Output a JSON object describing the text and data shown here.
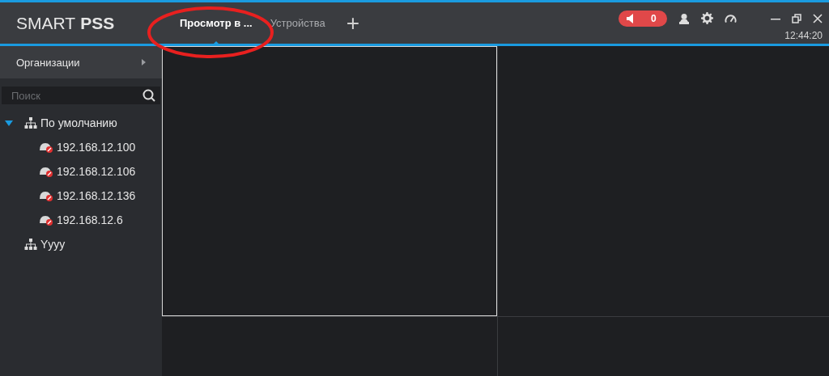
{
  "app": {
    "logo_light": "SMART",
    "logo_bold": "PSS"
  },
  "tabs": [
    {
      "label": "Просмотр в ...",
      "selected": true
    },
    {
      "label": "Устройства",
      "selected": false
    }
  ],
  "add_tab": "+",
  "alarm": {
    "count": "0"
  },
  "clock": "12:44:20",
  "sidebar": {
    "header": "Организации",
    "search": {
      "placeholder": "Поиск"
    },
    "tree": [
      {
        "label": "По умолчанию",
        "expanded": true,
        "children": [
          {
            "label": "192.168.12.100"
          },
          {
            "label": "192.168.12.106"
          },
          {
            "label": "192.168.12.136"
          },
          {
            "label": "192.168.12.6"
          }
        ]
      },
      {
        "label": "Yyyy"
      }
    ]
  },
  "video_tiles": [
    {
      "selected": true
    },
    {
      "selected": false
    },
    {
      "selected": false
    },
    {
      "selected": false
    }
  ],
  "annotation": {
    "kind": "ellipse"
  }
}
